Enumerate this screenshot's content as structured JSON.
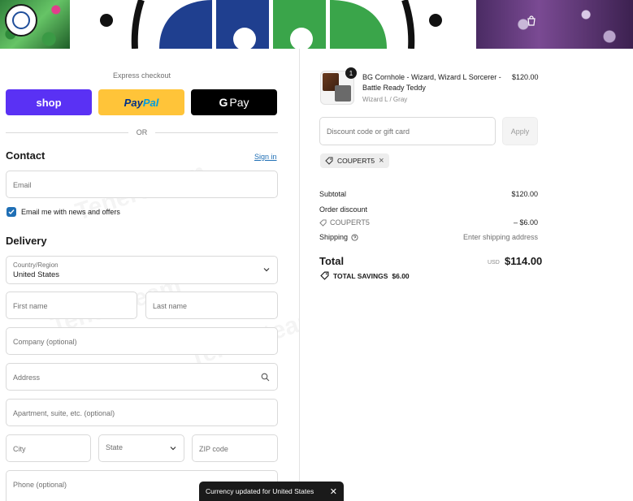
{
  "express": {
    "label": "Express checkout",
    "shop_label": "shop",
    "paypal_label_1": "Pay",
    "paypal_label_2": "Pal",
    "gpay_label_g": "G",
    "gpay_label": "Pay",
    "or_label": "OR"
  },
  "contact": {
    "heading": "Contact",
    "signin": "Sign in",
    "email_placeholder": "Email",
    "newsletter_label": "Email me with news and offers",
    "newsletter_checked": true
  },
  "delivery": {
    "heading": "Delivery",
    "country_label": "Country/Region",
    "country_value": "United States",
    "first_name_placeholder": "First name",
    "last_name_placeholder": "Last name",
    "company_placeholder": "Company (optional)",
    "address_placeholder": "Address",
    "apartment_placeholder": "Apartment, suite, etc. (optional)",
    "city_placeholder": "City",
    "state_placeholder": "State",
    "zip_placeholder": "ZIP code",
    "phone_placeholder": "Phone (optional)"
  },
  "order": {
    "item_name": "BG Cornhole - Wizard, Wizard L Sorcerer - Battle Ready Teddy",
    "item_variant": "Wizard L / Gray",
    "item_price": "$120.00",
    "item_qty": "1",
    "discount_placeholder": "Discount code or gift card",
    "apply_label": "Apply",
    "applied_code": "COUPERT5",
    "subtotal_label": "Subtotal",
    "subtotal_value": "$120.00",
    "order_discount_label": "Order discount",
    "discount_code_label": "COUPERT5",
    "discount_value": "– $6.00",
    "shipping_label": "Shipping",
    "shipping_value": "Enter shipping address",
    "total_label": "Total",
    "total_currency": "USD",
    "total_value": "$114.00",
    "savings_label": "TOTAL SAVINGS",
    "savings_value": "$6.00"
  },
  "toast": {
    "message": "Currency updated for United States"
  },
  "watermark": "Tenereteam",
  "colors": {
    "shop": "#5a31f4",
    "paypal": "#ffc439",
    "link": "#1f6fb5"
  }
}
